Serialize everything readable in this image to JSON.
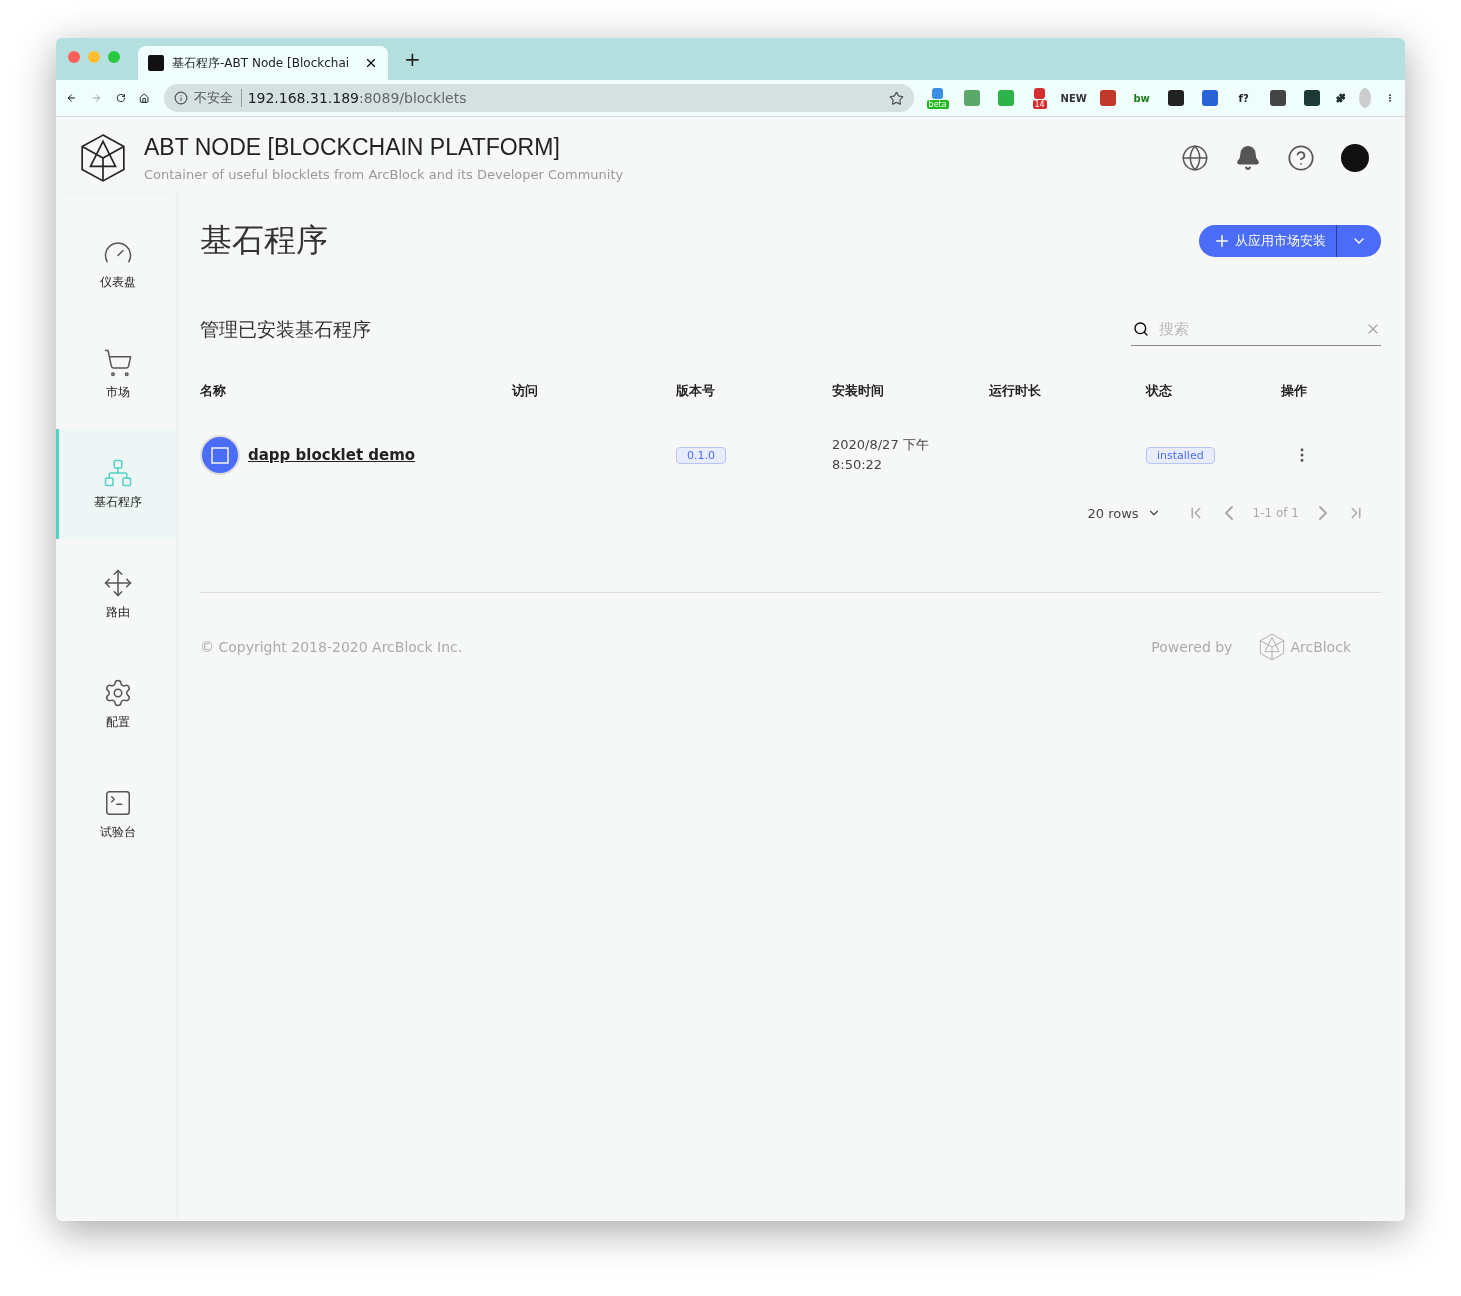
{
  "browser": {
    "tab_title": "基石程序-ABT Node [Blockchai",
    "new_tab": "+",
    "security": "不安全",
    "url_host": "192.168.31.189",
    "url_rest": ":8089/blocklets",
    "extensions": [
      {
        "kind": "badge",
        "badge": "beta"
      },
      {
        "kind": "plain"
      },
      {
        "kind": "plain"
      },
      {
        "kind": "badge",
        "badge": "14"
      },
      {
        "kind": "text",
        "text": "NEW"
      },
      {
        "kind": "plain"
      },
      {
        "kind": "text",
        "text": "bw"
      },
      {
        "kind": "plain"
      },
      {
        "kind": "plain"
      },
      {
        "kind": "text",
        "text": "f?"
      },
      {
        "kind": "plain"
      },
      {
        "kind": "plain"
      }
    ]
  },
  "header": {
    "title": "ABT NODE [BLOCKCHAIN PLATFORM]",
    "subtitle": "Container of useful blocklets from ArcBlock and its Developer Community"
  },
  "sidebar": {
    "items": [
      {
        "label": "仪表盘",
        "selected": false
      },
      {
        "label": "市场",
        "selected": false
      },
      {
        "label": "基石程序",
        "selected": true
      },
      {
        "label": "路由",
        "selected": false
      },
      {
        "label": "配置",
        "selected": false
      },
      {
        "label": "试验台",
        "selected": false
      }
    ]
  },
  "page": {
    "title": "基石程序",
    "install_button": "从应用市场安装"
  },
  "table": {
    "title": "管理已安装基石程序",
    "search_placeholder": "搜索",
    "columns": [
      "名称",
      "访问",
      "版本号",
      "安装时间",
      "运行时长",
      "状态",
      "操作"
    ],
    "rows": [
      {
        "name": "dapp blocklet demo",
        "version": "0.1.0",
        "installed_at": [
          "2020/8/27 下午",
          "8:50:22"
        ],
        "status": "installed"
      }
    ],
    "pagination": {
      "rows_per_page": "20 rows",
      "range": "1-1 of 1"
    }
  },
  "footer": {
    "copyright": "© Copyright 2018-2020  ArcBlock Inc.",
    "powered_by": "Powered by",
    "brand": "ArcBlock"
  }
}
